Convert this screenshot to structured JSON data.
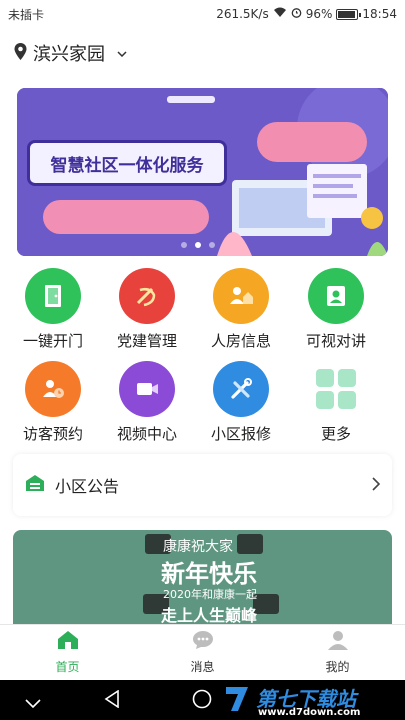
{
  "status": {
    "carrier": "未插卡",
    "speed": "261.5K/s",
    "battery": "96%",
    "battery_level": 0.96,
    "time": "18:54"
  },
  "location": {
    "name": "滨兴家园"
  },
  "banner": {
    "title": "智慧社区一体化服务",
    "slide_count": 3,
    "active_slide": 2
  },
  "grid": [
    {
      "label": "一键开门",
      "icon": "door-icon",
      "color": "#2fc25b"
    },
    {
      "label": "党建管理",
      "icon": "party-emblem-icon",
      "color": "#e8423d"
    },
    {
      "label": "人房信息",
      "icon": "person-house-icon",
      "color": "#f5a623"
    },
    {
      "label": "可视对讲",
      "icon": "video-intercom-icon",
      "color": "#2fc25b"
    },
    {
      "label": "访客预约",
      "icon": "visitor-icon",
      "color": "#f57b2a"
    },
    {
      "label": "视频中心",
      "icon": "video-camera-icon",
      "color": "#8b4bd6"
    },
    {
      "label": "小区报修",
      "icon": "repair-tools-icon",
      "color": "#2f8ce0"
    },
    {
      "label": "更多",
      "icon": "more-grid-icon",
      "color": "#a8e6c7"
    }
  ],
  "notice": {
    "label": "小区公告"
  },
  "poster": {
    "line1": "康康祝大家",
    "line2": "新年快乐",
    "line3": "2020年和康康一起",
    "line4": "走上人生巅峰"
  },
  "tabs": [
    {
      "label": "首页",
      "icon": "home-icon",
      "active": true
    },
    {
      "label": "消息",
      "icon": "message-icon",
      "active": false
    },
    {
      "label": "我的",
      "icon": "profile-icon",
      "active": false
    }
  ],
  "watermark": {
    "main": "第七下载站",
    "sub": "www.d7down.com"
  },
  "colors": {
    "accent": "#2dae58",
    "banner_bg": "#6b5ac8"
  }
}
